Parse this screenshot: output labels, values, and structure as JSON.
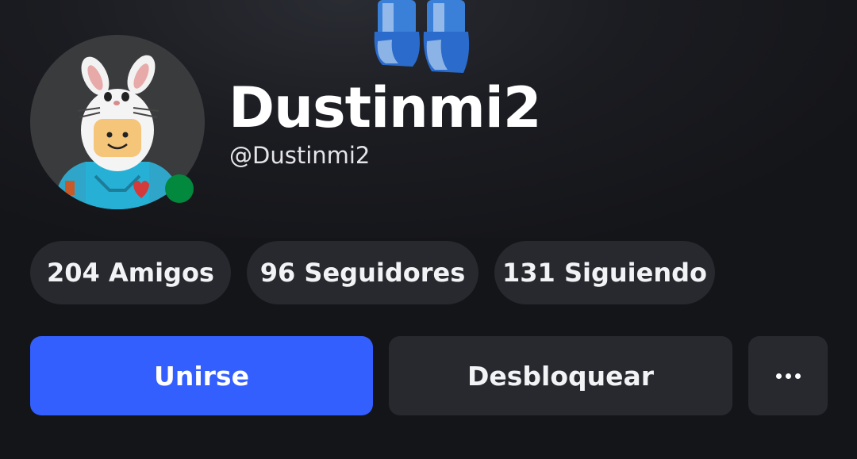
{
  "profile": {
    "display_name": "Dustinmi2",
    "username": "@Dustinmi2",
    "presence": "online"
  },
  "stats": {
    "friends_label": "204 Amigos",
    "followers_label": "96 Seguidores",
    "following_label": "131 Siguiendo"
  },
  "actions": {
    "join_label": "Unirse",
    "unblock_label": "Desbloquear",
    "more_icon": "ellipsis-icon"
  },
  "colors": {
    "background": "#141519",
    "pill": "#27292f",
    "primary_button": "#335fff",
    "presence_online": "#02893e"
  }
}
